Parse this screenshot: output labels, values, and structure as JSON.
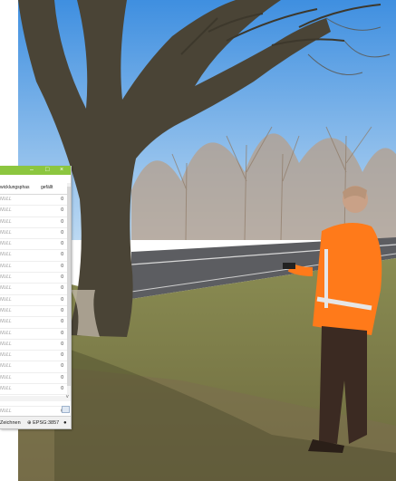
{
  "app": {
    "titlebar": {
      "min_icon": "minimize-icon",
      "max_icon": "maximize-icon",
      "close_icon": "close-icon",
      "min_label": "–",
      "max_label": "□",
      "close_label": "×"
    },
    "table": {
      "columns": [
        "wicklungsphas",
        "gefällt"
      ],
      "rows": [
        {
          "a": "NULL",
          "b": "0"
        },
        {
          "a": "NULL",
          "b": "0"
        },
        {
          "a": "NULL",
          "b": "0"
        },
        {
          "a": "NULL",
          "b": "0"
        },
        {
          "a": "NULL",
          "b": "0"
        },
        {
          "a": "NULL",
          "b": "0"
        },
        {
          "a": "NULL",
          "b": "0"
        },
        {
          "a": "NULL",
          "b": "0"
        },
        {
          "a": "NULL",
          "b": "0"
        },
        {
          "a": "NULL",
          "b": "0"
        },
        {
          "a": "NULL",
          "b": "0"
        },
        {
          "a": "NULL",
          "b": "0"
        },
        {
          "a": "NULL",
          "b": "0"
        },
        {
          "a": "NULL",
          "b": "0"
        },
        {
          "a": "NULL",
          "b": "0"
        },
        {
          "a": "NULL",
          "b": "0"
        },
        {
          "a": "NULL",
          "b": "0"
        },
        {
          "a": "NULL",
          "b": "0"
        },
        {
          "a": "NULL",
          "b": "0"
        },
        {
          "a": "NULL",
          "b": "0"
        }
      ]
    },
    "statusbar": {
      "draw_label": "Zeichnen",
      "epsg_label": "EPSG:3857",
      "globe_icon": "globe-icon",
      "message_icon": "message-icon"
    }
  },
  "colors": {
    "titlebar": "#8cc63f",
    "vest": "#ff7a1a"
  }
}
